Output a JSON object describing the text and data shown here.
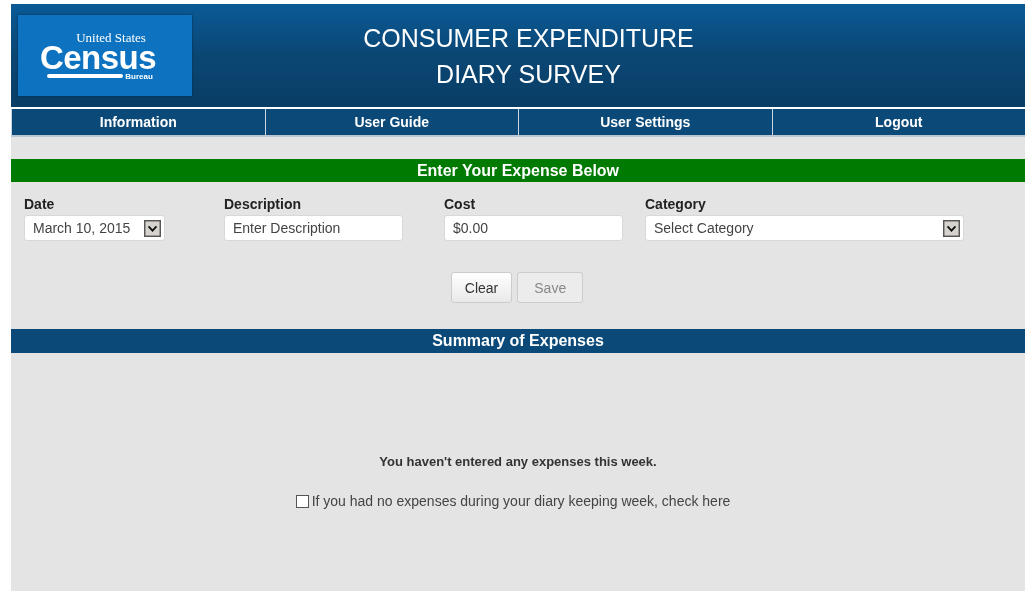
{
  "logo": {
    "line_1": "United States",
    "line_2": "Census",
    "line_3": "Bureau"
  },
  "header": {
    "title_line_1": "CONSUMER EXPENDITURE",
    "title_line_2": "DIARY SURVEY"
  },
  "nav": [
    {
      "label": "Information"
    },
    {
      "label": "User Guide"
    },
    {
      "label": "User Settings"
    },
    {
      "label": "Logout"
    }
  ],
  "entry": {
    "heading": "Enter Your Expense Below",
    "fields": [
      {
        "kind": "select",
        "label": "Date",
        "value": "March 10, 2015"
      },
      {
        "kind": "text",
        "label": "Description",
        "placeholder": "Enter Description"
      },
      {
        "kind": "text",
        "label": "Cost",
        "value": "$0.00"
      },
      {
        "kind": "select",
        "label": "Category",
        "value": "Select Category"
      }
    ],
    "buttons": [
      {
        "label": "Clear",
        "disabled": false
      },
      {
        "label": "Save",
        "disabled": true
      }
    ]
  },
  "summary": {
    "heading": "Summary of Expenses",
    "message": "You haven't entered any expenses this week.",
    "no_expenses": {
      "label": "If you had no expenses during your diary keeping week, check here",
      "checked": false
    }
  }
}
